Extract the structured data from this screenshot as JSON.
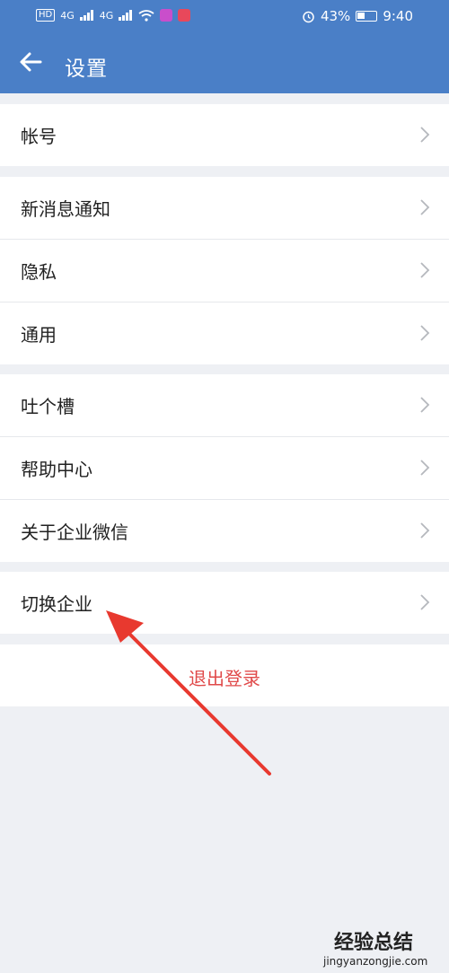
{
  "status": {
    "hd": "HD",
    "signal1": "4G",
    "signal2": "4G",
    "battery_text": "43%",
    "time": "9:40"
  },
  "header": {
    "title": "设置"
  },
  "groups": [
    {
      "items": [
        {
          "label": "帐号"
        }
      ]
    },
    {
      "items": [
        {
          "label": "新消息通知"
        },
        {
          "label": "隐私"
        },
        {
          "label": "通用"
        }
      ]
    },
    {
      "items": [
        {
          "label": "吐个槽"
        },
        {
          "label": "帮助中心"
        },
        {
          "label": "关于企业微信"
        }
      ]
    },
    {
      "items": [
        {
          "label": "切换企业"
        }
      ]
    }
  ],
  "logout_label": "退出登录",
  "watermark": {
    "title": "经验总结",
    "url": "jingyanzongjie.com"
  },
  "colors": {
    "header": "#4a7fc7",
    "background": "#eef0f4",
    "logout": "#e04a4a",
    "arrow": "#e8392f"
  },
  "icons": {
    "back": "arrow-left-icon",
    "chevron": "chevron-right-icon"
  }
}
